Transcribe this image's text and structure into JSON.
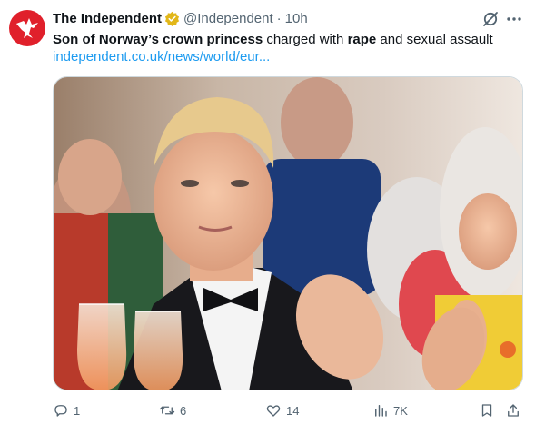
{
  "account": {
    "name": "The Independent",
    "handle": "@Independent",
    "separator": "·",
    "time": "10h"
  },
  "tweet": {
    "text_bold_1": "Son of Norway’s crown princess",
    "text_plain_1": " charged with ",
    "text_bold_2": "rape",
    "text_plain_2": " and sexual assault",
    "link": "independent.co.uk/news/world/eur..."
  },
  "icons": {
    "avatar": "independent-eagle-logo",
    "badge": "verified-gold-badge",
    "grok": "grok-icon",
    "more": "more-dots-icon",
    "reply": "reply-icon",
    "retweet": "retweet-icon",
    "like": "heart-icon",
    "views": "views-bar-icon",
    "bookmark": "bookmark-icon",
    "share": "share-icon"
  },
  "actions": {
    "replies": "1",
    "retweets": "6",
    "likes": "14",
    "views": "7K"
  },
  "colors": {
    "brand_red": "#e0202b",
    "link_blue": "#1d9bf0",
    "muted": "#536471",
    "badge_gold": "#e2b719"
  }
}
